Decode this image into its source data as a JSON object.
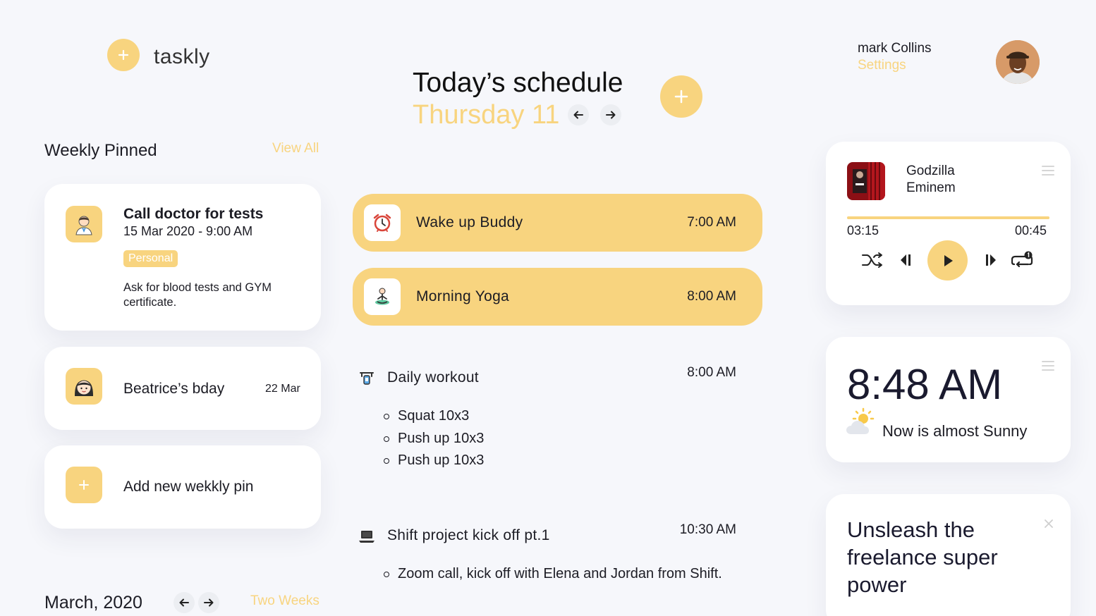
{
  "app": {
    "name": "taskly"
  },
  "user": {
    "name": "mark Collins",
    "settings_link": "Settings"
  },
  "schedule": {
    "title": "Today’s schedule",
    "day": "Thursday 11"
  },
  "pinned": {
    "title": "Weekly Pinned",
    "view_all": "View All",
    "items": [
      {
        "title": "Call doctor for tests",
        "datetime": "15 Mar 2020 - 9:00 AM",
        "tag": "Personal",
        "note": "Ask for blood tests and GYM certificate.",
        "icon": "doctor-icon"
      },
      {
        "title": "Beatrice’s bday",
        "date": "22 Mar",
        "icon": "woman-face-icon"
      }
    ],
    "add_label": "Add new wekkly pin"
  },
  "calendar": {
    "month": "March, 2020",
    "range_toggle": "Two Weeks"
  },
  "tasks": [
    {
      "name": "Wake up Buddy",
      "time": "7:00 AM",
      "icon": "alarm-clock-icon",
      "highlighted": true
    },
    {
      "name": "Morning Yoga",
      "time": "8:00 AM",
      "icon": "yoga-icon",
      "highlighted": true
    },
    {
      "name": "Daily workout",
      "time": "8:00 AM",
      "icon": "dumbbell-icon",
      "subitems": [
        "Squat 10x3",
        "Push up 10x3",
        "Push up 10x3"
      ]
    },
    {
      "name": "Shift project kick off pt.1",
      "time": "10:30 AM",
      "icon": "laptop-icon",
      "subitems": [
        "Zoom call, kick off with Elena and Jordan from Shift."
      ]
    }
  ],
  "music": {
    "song": "Godzilla",
    "artist": "Eminem",
    "elapsed": "03:15",
    "remaining": "00:45",
    "progress_fraction": 1.0
  },
  "clock": {
    "time": "8:48 AM",
    "weather": "Now is almost Sunny"
  },
  "promo": {
    "text": "Unsleash the freelance super power"
  },
  "colors": {
    "accent": "#f8d47f",
    "background": "#f6f7fb",
    "text": "#1c1c24"
  }
}
